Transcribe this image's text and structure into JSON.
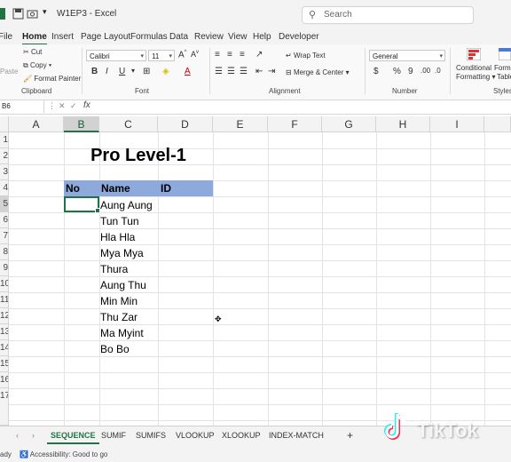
{
  "app": {
    "title": "W1EP3 - Excel",
    "brand_color": "#217346"
  },
  "search": {
    "placeholder": "Search"
  },
  "menu": {
    "items": [
      "File",
      "Home",
      "Insert",
      "Page Layout",
      "Formulas",
      "Data",
      "Review",
      "View",
      "Help",
      "Developer"
    ],
    "active": "Home"
  },
  "ribbon": {
    "clipboard": {
      "cut": "Cut",
      "copy": "Copy",
      "format_painter": "Format Painter",
      "paste": "Paste",
      "label": "Clipboard"
    },
    "font": {
      "name": "Calibri",
      "size": "11",
      "bold": "B",
      "italic": "I",
      "underline": "U",
      "label": "Font"
    },
    "alignment": {
      "wrap_text": "Wrap Text",
      "merge_center": "Merge & Center",
      "label": "Alignment"
    },
    "number": {
      "format": "General",
      "currency": "$",
      "percent": "%",
      "comma": "9",
      "label": "Number"
    },
    "styles": {
      "conditional": "Conditional",
      "formatting": "Formatting",
      "format_as": "Forma",
      "table": "Table",
      "label": "Styles"
    }
  },
  "formula_bar": {
    "name_box": "B6",
    "fx": "fx",
    "value": ""
  },
  "columns": [
    "A",
    "B",
    "C",
    "D",
    "E",
    "F",
    "G",
    "H",
    "I"
  ],
  "selected_column": "B",
  "rows": [
    "1",
    "2",
    "3",
    "4",
    "5",
    "6",
    "7",
    "8",
    "9",
    "10",
    "11",
    "12",
    "13",
    "14",
    "15",
    "16",
    "17"
  ],
  "sheet": {
    "title": "Pro Level-1",
    "headers": {
      "no": "No",
      "name": "Name",
      "id": "ID"
    },
    "names": [
      "Aung Aung",
      "Tun Tun",
      "Hla Hla",
      "Mya Mya",
      "Thura",
      "Aung Thu",
      "Min Min",
      "Thu Zar",
      "Ma Myint",
      "Bo Bo"
    ],
    "header_fill": "#8ea9db"
  },
  "tabs": {
    "items": [
      "SEQUENCE",
      "SUMIF",
      "SUMIFS",
      "VLOOKUP",
      "XLOOKUP",
      "INDEX-MATCH"
    ],
    "active": "SEQUENCE",
    "add": "+"
  },
  "status": {
    "ready": "ady",
    "accessibility": "Accessibility: Good to go"
  },
  "watermark": {
    "text": "TikTok"
  }
}
